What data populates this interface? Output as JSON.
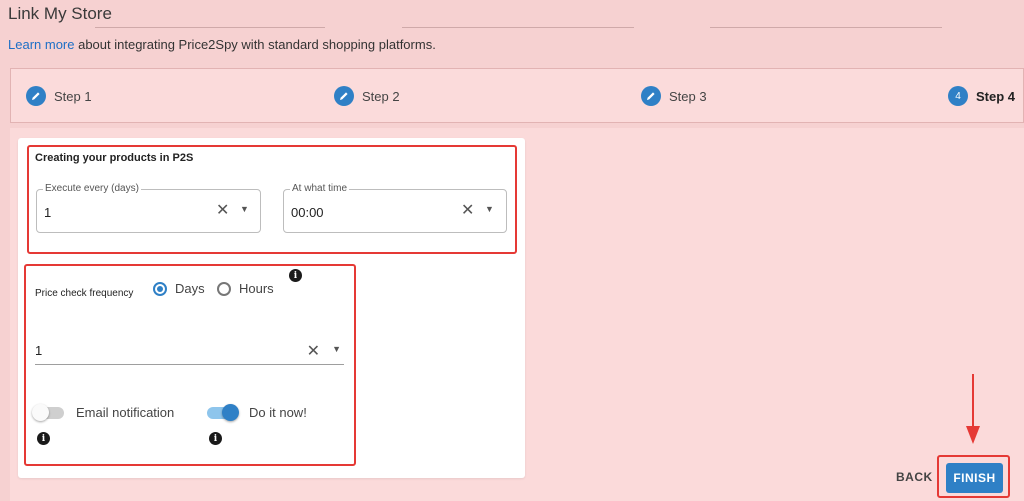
{
  "header": {
    "title": "Link My Store",
    "intro_link": "Learn more",
    "intro_text": " about integrating Price2Spy with standard shopping platforms."
  },
  "stepper": {
    "steps": [
      {
        "label": "Step 1",
        "icon": "pencil-icon",
        "state": "completed"
      },
      {
        "label": "Step 2",
        "icon": "pencil-icon",
        "state": "completed"
      },
      {
        "label": "Step 3",
        "icon": "pencil-icon",
        "state": "completed"
      },
      {
        "label": "Step 4",
        "number": "4",
        "state": "active"
      }
    ]
  },
  "creating": {
    "title": "Creating your products in P2S",
    "execute_every": {
      "label": "Execute every (days)",
      "value": "1"
    },
    "at_what_time": {
      "label": "At what time",
      "value": "00:00"
    }
  },
  "price_check": {
    "label": "Price check frequency",
    "options": [
      {
        "label": "Days",
        "checked": true
      },
      {
        "label": "Hours",
        "checked": false
      }
    ],
    "value": "1"
  },
  "toggles": {
    "email": {
      "label": "Email notification",
      "on": false
    },
    "do_now": {
      "label": "Do it now!",
      "on": true
    }
  },
  "actions": {
    "back": "BACK",
    "finish": "FINISH"
  },
  "colors": {
    "accent": "#2f80c6",
    "highlight": "#e53935",
    "background": "#f6d1d1"
  }
}
